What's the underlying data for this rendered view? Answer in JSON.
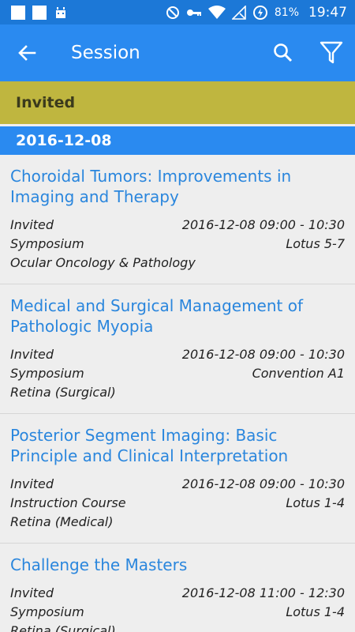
{
  "status_bar": {
    "battery": "81%",
    "time": "19:47"
  },
  "app_bar": {
    "title": "Session"
  },
  "filter_banner": {
    "label": "Invited"
  },
  "date_header": "2016-12-08",
  "sessions": [
    {
      "title": "Choroidal Tumors: Improvements in Imaging and Therapy",
      "type": "Invited",
      "datetime": "2016-12-08 09:00 - 10:30",
      "format": "Symposium",
      "room": "Lotus 5-7",
      "track": "Ocular Oncology & Pathology"
    },
    {
      "title": "Medical and Surgical Management of Pathologic Myopia",
      "type": "Invited",
      "datetime": "2016-12-08 09:00 - 10:30",
      "format": "Symposium",
      "room": "Convention A1",
      "track": "Retina (Surgical)"
    },
    {
      "title": "Posterior Segment Imaging: Basic Principle and Clinical Interpretation",
      "type": "Invited",
      "datetime": "2016-12-08 09:00 - 10:30",
      "format": "Instruction Course",
      "room": "Lotus 1-4",
      "track": "Retina (Medical)"
    },
    {
      "title": "Challenge the Masters",
      "type": "Invited",
      "datetime": "2016-12-08 11:00 - 12:30",
      "format": "Symposium",
      "room": "Lotus 1-4",
      "track": "Retina (Surgical)"
    }
  ],
  "colors": {
    "primary": "#2a8af0",
    "status_bar": "#1c78d7",
    "banner": "#bfb63f",
    "link": "#2a86dd"
  },
  "icons": [
    "back-arrow-icon",
    "search-icon",
    "filter-icon"
  ]
}
